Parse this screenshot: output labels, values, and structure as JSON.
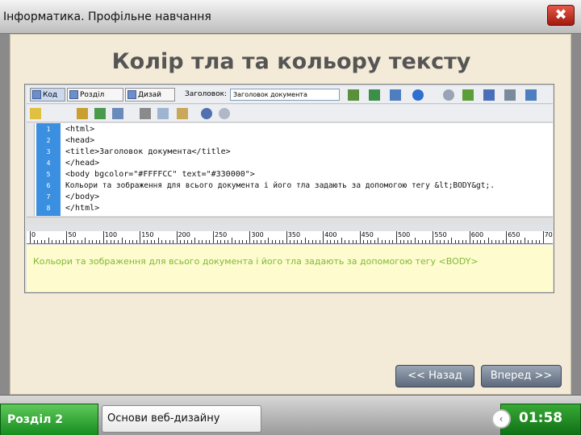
{
  "window": {
    "title": "Інформатика. Профільне навчання",
    "close_glyph": "✖"
  },
  "slide": {
    "title": "Колір тла та кольору тексту"
  },
  "editor": {
    "toolbar": {
      "code_label": "Код",
      "split_label": "Розділ",
      "design_label": "Дизай",
      "title_label": "Заголовок:",
      "title_value": "Заголовок документа"
    },
    "lines": [
      {
        "num": "1",
        "text": "<html>"
      },
      {
        "num": "2",
        "text": "<head>"
      },
      {
        "num": "3",
        "text": "<title>Заголовок документа</title>"
      },
      {
        "num": "4",
        "text": "</head>"
      },
      {
        "num": "5",
        "text": "<body bgcolor=\"#FFFFCC\" text=\"#330000\">"
      },
      {
        "num": "6",
        "text": "Кольори та зображення для всього документа і його тла задають за допомогою тегу &lt;BODY&gt;."
      },
      {
        "num": "7",
        "text": "</body>"
      },
      {
        "num": "8",
        "text": "</html>"
      }
    ],
    "ruler_labels": [
      "0",
      "50",
      "100",
      "150",
      "200",
      "250",
      "300",
      "350",
      "400",
      "450",
      "500",
      "550",
      "600",
      "650",
      "70"
    ],
    "preview_text": "Кольори та зображення для всього документа і його тла задають за допомогою тегу <BODY>",
    "preview_bg": "#FFFFCC",
    "preview_text_color": "#7FB832"
  },
  "nav": {
    "back_label": "<< Назад",
    "forward_label": "Вперед >>"
  },
  "footer": {
    "section_label": "Розділ 2",
    "topic_label": "Основи веб-дизайну",
    "timer": "01:58"
  },
  "colors": {
    "accent_green": "#1E9A2A",
    "close_red": "#C8281C",
    "line_number_blue": "#3B8FE0"
  }
}
